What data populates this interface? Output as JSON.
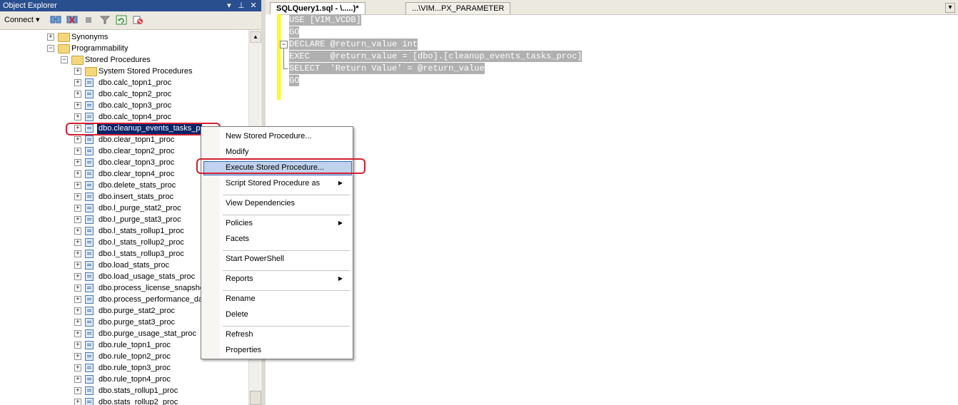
{
  "object_explorer": {
    "title": "Object Explorer",
    "title_buttons": [
      "▾",
      "⊥",
      "✕"
    ],
    "connect_label": "Connect ▾",
    "tree": [
      {
        "label": "Synonyms",
        "type": "folder",
        "expander": "+"
      },
      {
        "label": "Programmability",
        "type": "folder",
        "expander": "−"
      },
      {
        "label": "Stored Procedures",
        "type": "folder",
        "expander": "−"
      },
      {
        "label": "System Stored Procedures",
        "type": "folder",
        "expander": "+"
      },
      {
        "label": "dbo.calc_topn1_proc",
        "type": "proc",
        "expander": "+"
      },
      {
        "label": "dbo.calc_topn2_proc",
        "type": "proc",
        "expander": "+"
      },
      {
        "label": "dbo.calc_topn3_proc",
        "type": "proc",
        "expander": "+"
      },
      {
        "label": "dbo.calc_topn4_proc",
        "type": "proc",
        "expander": "+"
      },
      {
        "label": "dbo.cleanup_events_tasks_p",
        "type": "proc",
        "expander": "+",
        "selected": true
      },
      {
        "label": "dbo.clear_topn1_proc",
        "type": "proc",
        "expander": "+"
      },
      {
        "label": "dbo.clear_topn2_proc",
        "type": "proc",
        "expander": "+"
      },
      {
        "label": "dbo.clear_topn3_proc",
        "type": "proc",
        "expander": "+"
      },
      {
        "label": "dbo.clear_topn4_proc",
        "type": "proc",
        "expander": "+"
      },
      {
        "label": "dbo.delete_stats_proc",
        "type": "proc",
        "expander": "+"
      },
      {
        "label": "dbo.insert_stats_proc",
        "type": "proc",
        "expander": "+"
      },
      {
        "label": "dbo.l_purge_stat2_proc",
        "type": "proc",
        "expander": "+"
      },
      {
        "label": "dbo.l_purge_stat3_proc",
        "type": "proc",
        "expander": "+"
      },
      {
        "label": "dbo.l_stats_rollup1_proc",
        "type": "proc",
        "expander": "+"
      },
      {
        "label": "dbo.l_stats_rollup2_proc",
        "type": "proc",
        "expander": "+"
      },
      {
        "label": "dbo.l_stats_rollup3_proc",
        "type": "proc",
        "expander": "+"
      },
      {
        "label": "dbo.load_stats_proc",
        "type": "proc",
        "expander": "+"
      },
      {
        "label": "dbo.load_usage_stats_proc",
        "type": "proc",
        "expander": "+"
      },
      {
        "label": "dbo.process_license_snapsho",
        "type": "proc",
        "expander": "+"
      },
      {
        "label": "dbo.process_performance_da",
        "type": "proc",
        "expander": "+"
      },
      {
        "label": "dbo.purge_stat2_proc",
        "type": "proc",
        "expander": "+"
      },
      {
        "label": "dbo.purge_stat3_proc",
        "type": "proc",
        "expander": "+"
      },
      {
        "label": "dbo.purge_usage_stat_proc",
        "type": "proc",
        "expander": "+"
      },
      {
        "label": "dbo.rule_topn1_proc",
        "type": "proc",
        "expander": "+"
      },
      {
        "label": "dbo.rule_topn2_proc",
        "type": "proc",
        "expander": "+"
      },
      {
        "label": "dbo.rule_topn3_proc",
        "type": "proc",
        "expander": "+"
      },
      {
        "label": "dbo.rule_topn4_proc",
        "type": "proc",
        "expander": "+"
      },
      {
        "label": "dbo.stats_rollup1_proc",
        "type": "proc",
        "expander": "+"
      },
      {
        "label": "dbo.stats_rollup2_proc",
        "type": "proc",
        "expander": "+"
      }
    ]
  },
  "editor": {
    "tabs": [
      {
        "label": "SQLQuery1.sql - \\.....)*"
      },
      {
        "label": "...\\VIM...PX_PARAMETER"
      }
    ],
    "code_lines": [
      "USE [VIM_VCDB]",
      "GO",
      "DECLARE @return_value int",
      "EXEC    @return_value = [dbo].[cleanup_events_tasks_proc]",
      "SELECT  'Return Value' = @return_value",
      "GO"
    ]
  },
  "context_menu": {
    "items": [
      {
        "label": "New Stored Procedure..."
      },
      {
        "label": "Modify"
      },
      {
        "label": "Execute Stored Procedure...",
        "highlighted": true
      },
      {
        "label": "Script Stored Procedure as",
        "submenu": true
      },
      {
        "separator": true
      },
      {
        "label": "View Dependencies"
      },
      {
        "separator": true
      },
      {
        "label": "Policies",
        "submenu": true
      },
      {
        "label": "Facets"
      },
      {
        "separator": true
      },
      {
        "label": "Start PowerShell"
      },
      {
        "separator": true
      },
      {
        "label": "Reports",
        "submenu": true
      },
      {
        "separator": true
      },
      {
        "label": "Rename"
      },
      {
        "label": "Delete"
      },
      {
        "separator": true
      },
      {
        "label": "Refresh"
      },
      {
        "label": "Properties"
      }
    ]
  },
  "colors": {
    "titlebar": "#2a4f8f",
    "selection": "#0a246a",
    "annotation": "#d4202f",
    "menu_highlight": "#c1d2ee",
    "code_highlight": "#b0b0b0",
    "gutter": "#ffff00"
  }
}
